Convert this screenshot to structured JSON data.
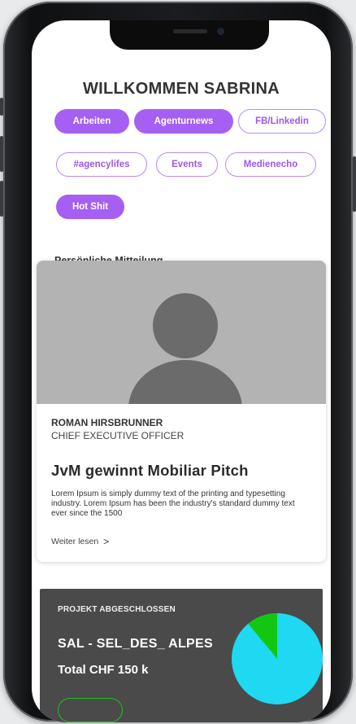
{
  "header": {
    "title": "WILLKOMMEN SABRINA"
  },
  "filters": [
    {
      "label": "Arbeiten",
      "active": true
    },
    {
      "label": "Agenturnews",
      "active": true
    },
    {
      "label": "FB/Linkedin",
      "active": false
    },
    {
      "label": "#agencylifes",
      "active": false
    },
    {
      "label": "Events",
      "active": false
    },
    {
      "label": "Medienecho",
      "active": false
    },
    {
      "label": "Hot Shit",
      "active": true
    }
  ],
  "message": {
    "section_label": "Persönliche Mitteilung",
    "avatar_icon": "person-placeholder",
    "author_name": "ROMAN HIRSBRUNNER",
    "author_role": "CHIEF EXECUTIVE OFFICER",
    "headline": "JvM gewinnt Mobiliar Pitch",
    "body": "Lorem Ipsum is simply dummy text of the printing and typesetting industry. Lorem Ipsum has been the industry's standard dummy text ever since the 1500",
    "read_more": "Weiter lesen",
    "read_more_icon": "chevron-right"
  },
  "project": {
    "status": "PROJEKT ABGESCHLOSSEN",
    "name": "SAL - SEL_DES_ ALPES",
    "total": "Total CHF 150 k",
    "pie_share": 0.11,
    "colors": {
      "main": "#1fd9f2",
      "accent": "#12c712"
    }
  },
  "colors": {
    "accent": "#a55ff2",
    "card_dark": "#4a4a4a"
  }
}
